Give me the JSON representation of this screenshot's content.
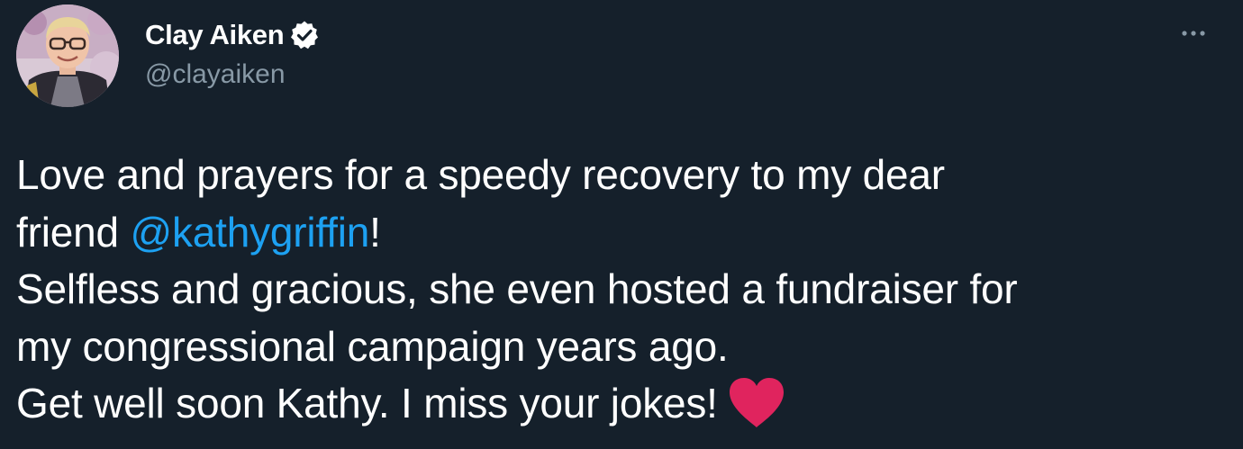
{
  "tweet": {
    "author": {
      "display_name": "Clay Aiken",
      "handle": "@clayaiken",
      "verified": true,
      "avatar_icon": "profile-photo"
    },
    "more_icon": "more-horizontal-icon",
    "body": {
      "line1": "Love and prayers for a speedy recovery to my dear",
      "line2_prefix": "friend ",
      "line2_mention": "@kathygriffin",
      "line2_suffix": "!",
      "line3": "Selfless and gracious, she even hosted a fundraiser for",
      "line4": "my congressional campaign years ago.",
      "line5": "Get well soon Kathy. I miss your jokes!",
      "emoji": "heart-icon"
    }
  },
  "colors": {
    "background": "#15202b",
    "text": "#ffffff",
    "secondary_text": "#8899a6",
    "link": "#1da1f2",
    "heart": "#e0245e"
  }
}
